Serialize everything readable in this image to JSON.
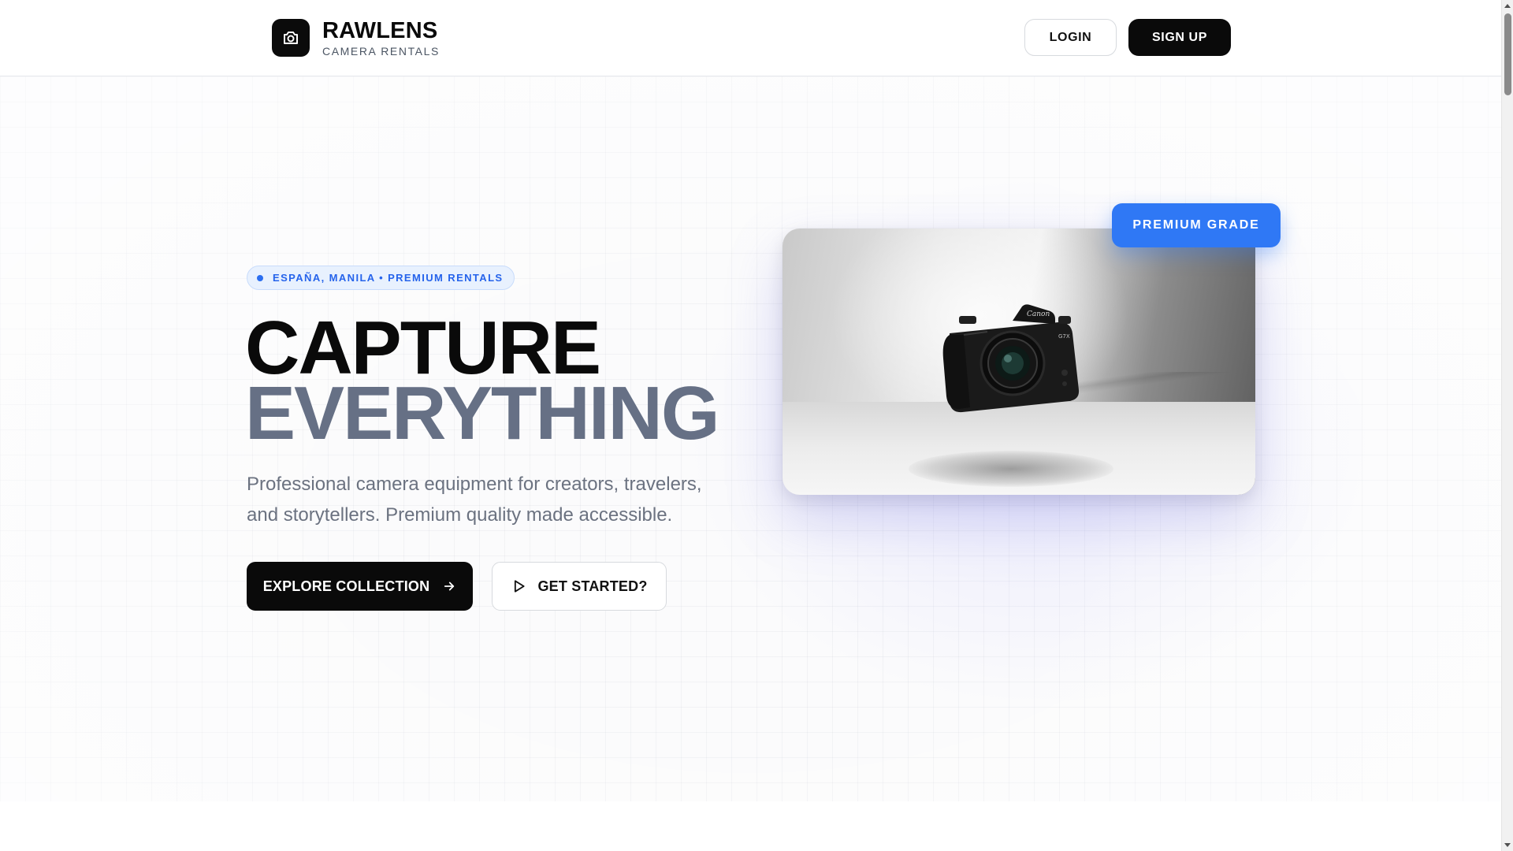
{
  "header": {
    "brand_name": "RAWLENS",
    "brand_sub": "CAMERA RENTALS",
    "logo_icon": "camera-icon",
    "login_label": "LOGIN",
    "signup_label": "SIGN UP"
  },
  "hero": {
    "tag": "ESPAÑA, MANILA • PREMIUM RENTALS",
    "title_line1": "CAPTURE",
    "title_line2": "EVERYTHING",
    "subtitle": "Professional camera equipment for creators, travelers, and storytellers. Premium quality made accessible.",
    "primary_cta": "EXPLORE COLLECTION",
    "secondary_cta": "GET STARTED?",
    "badge": "PREMIUM GRADE",
    "image": {
      "subject": "Canon camera",
      "camera_brand_text": "Canon",
      "camera_model_text": "G7X"
    }
  },
  "colors": {
    "primary_dark": "#0a0a0a",
    "accent_blue": "#2f78f5",
    "title_gray": "#667085",
    "text_gray": "#6b7280"
  },
  "icons": {
    "primary_cta_icon": "arrow-right-icon",
    "secondary_cta_icon": "play-icon"
  }
}
